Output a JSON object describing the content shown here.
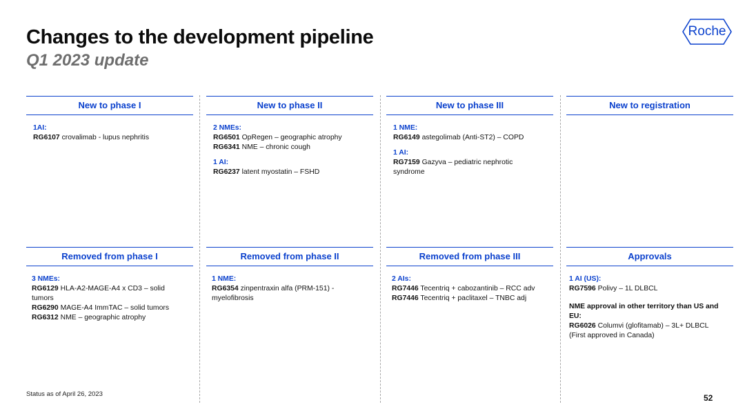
{
  "title": "Changes to the development pipeline",
  "subtitle": "Q1 2023 update",
  "logo": {
    "text": "Roche",
    "color": "#0b41cd"
  },
  "accent_color": "#0b41cd",
  "sections": {
    "new_phase1": {
      "heading": "New to phase I",
      "groups": [
        {
          "label": "1AI:",
          "items": [
            {
              "code": "RG6107",
              "text": " crovalimab - lupus nephritis"
            }
          ]
        }
      ]
    },
    "new_phase2": {
      "heading": "New to phase II",
      "groups": [
        {
          "label": "2 NMEs:",
          "items": [
            {
              "code": "RG6501",
              "text": " OpRegen – geographic atrophy"
            },
            {
              "code": "RG6341",
              "text": " NME – chronic cough"
            }
          ]
        },
        {
          "label": "1 AI:",
          "items": [
            {
              "code": "RG6237",
              "text": " latent myostatin – FSHD"
            }
          ]
        }
      ]
    },
    "new_phase3": {
      "heading": "New to phase III",
      "groups": [
        {
          "label": "1 NME:",
          "items": [
            {
              "code": "RG6149",
              "text": " astegolimab (Anti-ST2) – COPD"
            }
          ]
        },
        {
          "label": "1 AI:",
          "items": [
            {
              "code": "RG7159",
              "text": " Gazyva – pediatric nephrotic syndrome"
            }
          ]
        }
      ]
    },
    "new_registration": {
      "heading": "New to registration",
      "groups": []
    },
    "removed_phase1": {
      "heading": "Removed from phase I",
      "groups": [
        {
          "label": "3 NMEs:",
          "items": [
            {
              "code": "RG6129",
              "text": " HLA-A2-MAGE-A4 x CD3 – solid tumors"
            },
            {
              "code": "RG6290",
              "text": " MAGE-A4 ImmTAC – solid tumors"
            },
            {
              "code": "RG6312",
              "text": " NME – geographic atrophy"
            }
          ]
        }
      ]
    },
    "removed_phase2": {
      "heading": "Removed from phase II",
      "groups": [
        {
          "label": "1 NME:",
          "items": [
            {
              "code": "RG6354",
              "text": " zinpentraxin alfa (PRM-151) - myelofibrosis"
            }
          ]
        }
      ]
    },
    "removed_phase3": {
      "heading": "Removed from phase III",
      "groups": [
        {
          "label": "2 AIs:",
          "items": [
            {
              "code": "RG7446",
              "text": " Tecentriq + cabozantinib – RCC adv"
            },
            {
              "code": "RG7446",
              "text": " Tecentriq + paclitaxel – TNBC adj"
            }
          ]
        }
      ]
    },
    "approvals": {
      "heading": "Approvals",
      "groups": [
        {
          "label": "1 AI (US):",
          "items": [
            {
              "code": "RG7596",
              "text": " Polivy – 1L DLBCL"
            }
          ]
        }
      ],
      "note_heading": "NME approval in other territory than US and EU:",
      "note_items": [
        {
          "code": "RG6026",
          "text": " Columvi (glofitamab) – 3L+ DLBCL"
        }
      ],
      "note_extra": "(First approved in Canada)"
    }
  },
  "footer": "Status as of April 26, 2023",
  "page_number": "52"
}
